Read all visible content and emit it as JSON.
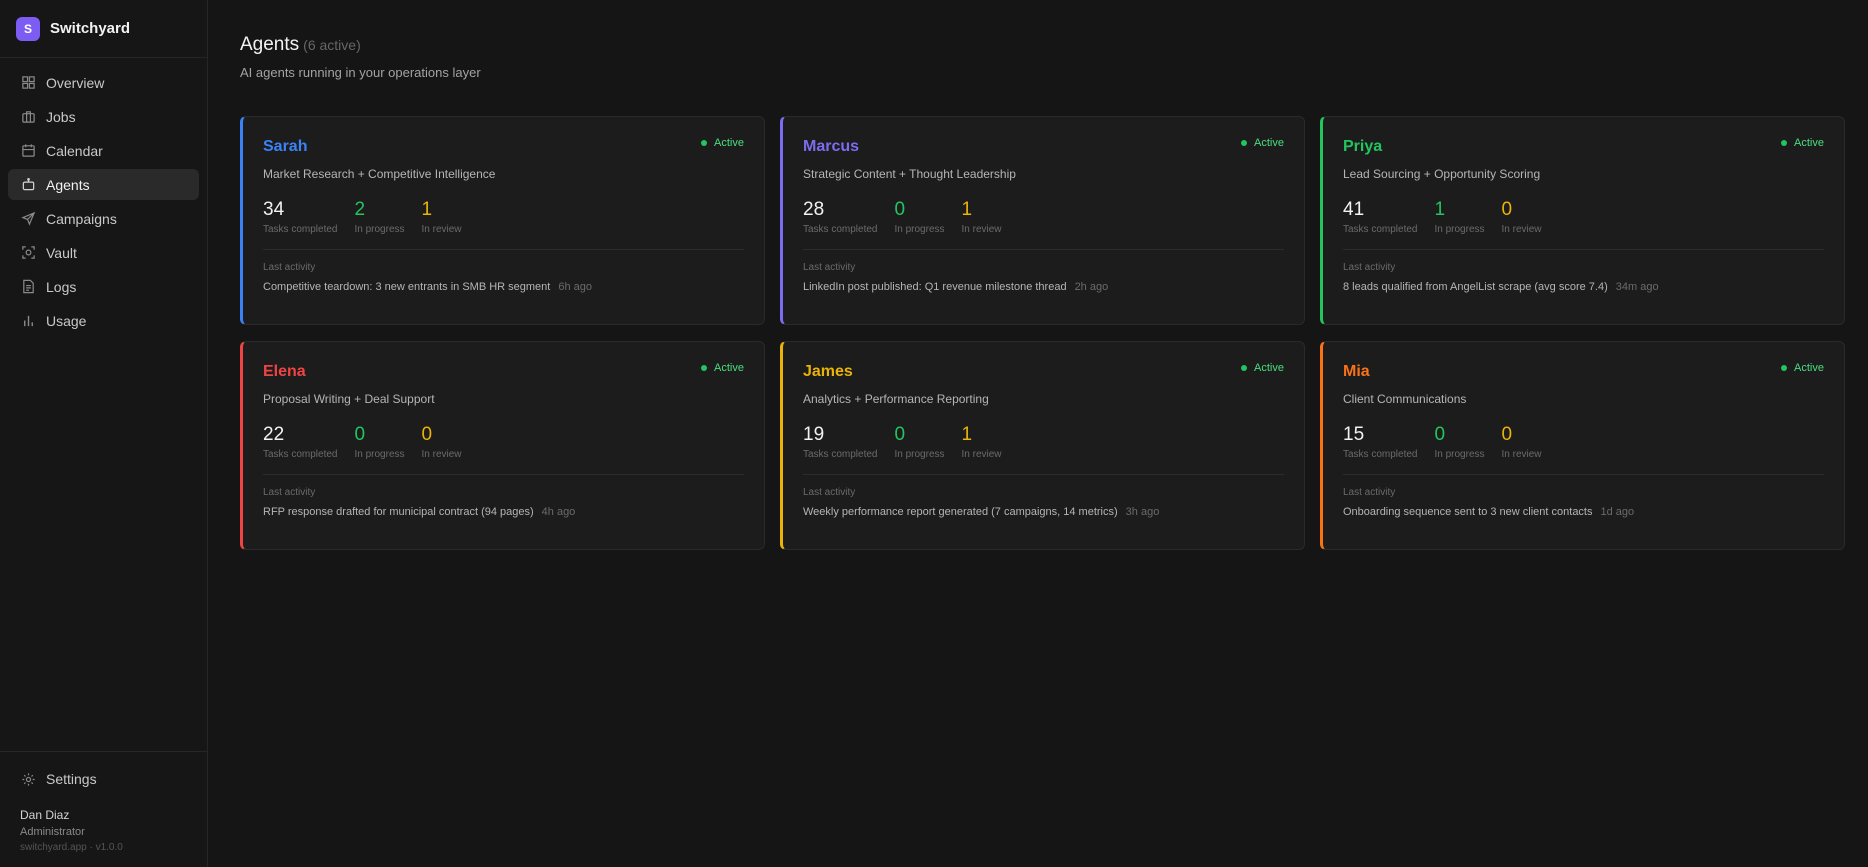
{
  "brand": {
    "logo_letter": "S",
    "name": "Switchyard"
  },
  "nav": [
    {
      "label": "Overview",
      "icon": "grid-icon",
      "active": false
    },
    {
      "label": "Jobs",
      "icon": "briefcase-icon",
      "active": false
    },
    {
      "label": "Calendar",
      "icon": "calendar-icon",
      "active": false
    },
    {
      "label": "Agents",
      "icon": "robot-icon",
      "active": true
    },
    {
      "label": "Campaigns",
      "icon": "send-icon",
      "active": false
    },
    {
      "label": "Vault",
      "icon": "vault-icon",
      "active": false
    },
    {
      "label": "Logs",
      "icon": "document-icon",
      "active": false
    },
    {
      "label": "Usage",
      "icon": "bar-chart-icon",
      "active": false
    }
  ],
  "settings": {
    "label": "Settings",
    "icon": "gear-icon"
  },
  "user": {
    "name": "Dan Diaz",
    "role": "Administrator",
    "footer": "switchyard.app · v1.0.0"
  },
  "page": {
    "title": "Agents",
    "active_count": "(6 active)",
    "subtitle": "AI agents running in your operations layer"
  },
  "labels": {
    "tasks_completed": "Tasks completed",
    "in_progress": "In progress",
    "in_review": "In review",
    "last_activity": "Last activity",
    "status": "Active"
  },
  "colors": {
    "active_status": "#22c55e",
    "completed": "#f2f2f2",
    "in_progress": "#22c55e",
    "in_review": "#eab308"
  },
  "agents": [
    {
      "name": "Sarah",
      "color": "#3b82f6",
      "role": "Market Research + Competitive Intelligence",
      "completed": "34",
      "in_progress": "2",
      "in_review": "1",
      "last_activity": "Competitive teardown: 3 new entrants in SMB HR segment",
      "last_activity_time": "6h ago"
    },
    {
      "name": "Marcus",
      "color": "#7c6cf0",
      "role": "Strategic Content + Thought Leadership",
      "completed": "28",
      "in_progress": "0",
      "in_review": "1",
      "last_activity": "LinkedIn post published: Q1 revenue milestone thread",
      "last_activity_time": "2h ago"
    },
    {
      "name": "Priya",
      "color": "#22c55e",
      "role": "Lead Sourcing + Opportunity Scoring",
      "completed": "41",
      "in_progress": "1",
      "in_review": "0",
      "last_activity": "8 leads qualified from AngelList scrape (avg score 7.4)",
      "last_activity_time": "34m ago"
    },
    {
      "name": "Elena",
      "color": "#ef4444",
      "role": "Proposal Writing + Deal Support",
      "completed": "22",
      "in_progress": "0",
      "in_review": "0",
      "last_activity": "RFP response drafted for municipal contract (94 pages)",
      "last_activity_time": "4h ago"
    },
    {
      "name": "James",
      "color": "#eab308",
      "role": "Analytics + Performance Reporting",
      "completed": "19",
      "in_progress": "0",
      "in_review": "1",
      "last_activity": "Weekly performance report generated (7 campaigns, 14 metrics)",
      "last_activity_time": "3h ago"
    },
    {
      "name": "Mia",
      "color": "#f97316",
      "role": "Client Communications",
      "completed": "15",
      "in_progress": "0",
      "in_review": "0",
      "last_activity": "Onboarding sequence sent to 3 new client contacts",
      "last_activity_time": "1d ago"
    }
  ]
}
